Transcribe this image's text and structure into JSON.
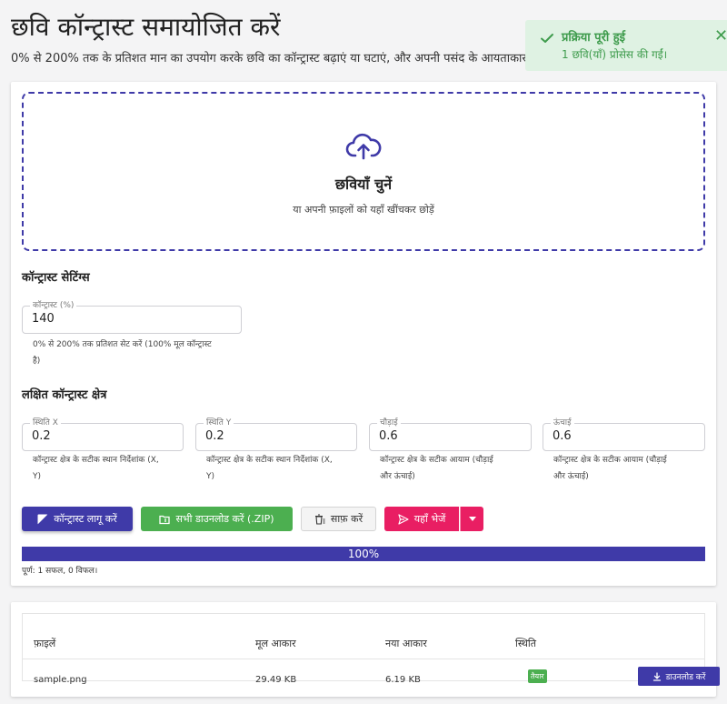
{
  "page": {
    "title": "छवि कॉन्ट्रास्ट समायोजित करें",
    "subtitle": "0% से 200% तक के प्रतिशत मान का उपयोग करके छवि का कॉन्ट्रास्ट बढ़ाएं या घटाएं, और अपनी पसंद के आयताकार"
  },
  "toast": {
    "title": "प्रक्रिया पूरी हुई",
    "message": "1 छवि(याँ) प्रोसेस की गईं।",
    "close": "✕"
  },
  "dropzone": {
    "title": "छवियाँ चुनें",
    "subtitle": "या अपनी फ़ाइलों को यहाँ खींचकर छोड़ें"
  },
  "contrast_settings": {
    "heading": "कॉन्ट्रास्ट सेटिंग्स",
    "field_label": "कॉन्ट्रास्ट (%)",
    "value": "140",
    "hint_line1": "0% से 200% तक प्रतिशत सेट करें (100% मूल कॉन्ट्रास्ट",
    "hint_line2": "है)"
  },
  "region": {
    "heading": "लक्षित कॉन्ट्रास्ट क्षेत्र",
    "fields": [
      {
        "label": "स्थिति X",
        "value": "0.2",
        "hint_line1": "कॉन्ट्रास्ट क्षेत्र के सटीक स्थान निर्देशांक (X,",
        "hint_line2": "Y)"
      },
      {
        "label": "स्थिति Y",
        "value": "0.2",
        "hint_line1": "कॉन्ट्रास्ट क्षेत्र के सटीक स्थान निर्देशांक (X,",
        "hint_line2": "Y)"
      },
      {
        "label": "चौड़ाई",
        "value": "0.6",
        "hint_line1": "कॉन्ट्रास्ट क्षेत्र के सटीक आयाम (चौड़ाई",
        "hint_line2": "और ऊंचाई)"
      },
      {
        "label": "ऊंचाई",
        "value": "0.6",
        "hint_line1": "कॉन्ट्रास्ट क्षेत्र के सटीक आयाम (चौड़ाई",
        "hint_line2": "और ऊंचाई)"
      }
    ]
  },
  "actions": {
    "apply": "कॉन्ट्रास्ट लागू करें",
    "download_zip": "सभी डाउनलोड करें (.ZIP)",
    "clear": "साफ़ करें",
    "send": "यहाँ भेजें"
  },
  "progress": {
    "percent": 100,
    "label": "100%",
    "status": "पूर्ण: 1 सफल, 0 विफल।"
  },
  "table": {
    "headers": {
      "file": "फ़ाइलें",
      "original_size": "मूल आकार",
      "new_size": "नया आकार",
      "status": "स्थिति"
    },
    "rows": [
      {
        "file": "sample.png",
        "original_size": "29.49 KB",
        "new_size": "6.19 KB",
        "status": "तैयार",
        "action": "डाउनलोड करें"
      }
    ]
  },
  "colors": {
    "primary": "#3f3aa8",
    "success": "#4caf50",
    "accent": "#e91e63"
  }
}
